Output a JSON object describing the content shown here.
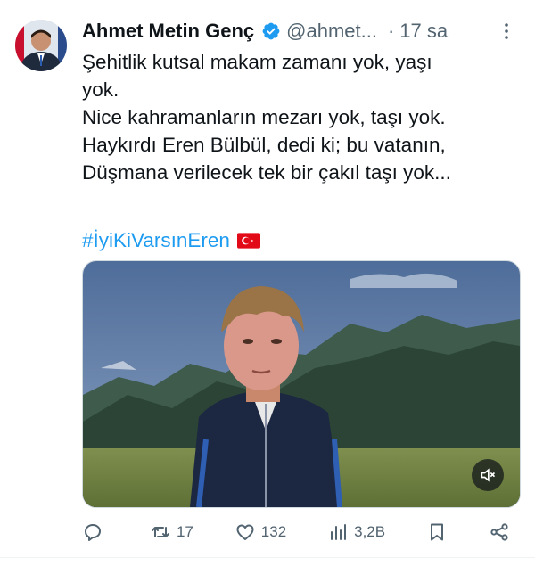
{
  "tweet": {
    "author_name": "Ahmet Metin Genç",
    "handle": "@ahmet...",
    "separator": "·",
    "time": "17 sa",
    "text_lines": [
      "Şehitlik kutsal makam zamanı yok, yaşı",
      "yok.",
      "Nice kahramanların mezarı yok, taşı yok.",
      "Haykırdı Eren Bülbül, dedi ki; bu vatanın,",
      "Düşmana verilecek tek bir çakıl taşı yok..."
    ],
    "hashtag": "#İyiKiVarsınEren"
  },
  "icons": {
    "verified": "verified-badge-icon",
    "more": "more-icon",
    "flag": "turkey-flag-icon",
    "mute": "muted-speaker-icon",
    "reply": "reply-icon",
    "retweet": "retweet-icon",
    "like": "heart-icon",
    "views": "views-icon",
    "bookmark": "bookmark-icon",
    "share": "share-icon"
  },
  "actions": {
    "reply_count": "",
    "retweet_count": "17",
    "like_count": "132",
    "views_count": "3,2B"
  },
  "colors": {
    "accent": "#1d9bf0",
    "text": "#0f1419",
    "secondary": "#536471"
  }
}
